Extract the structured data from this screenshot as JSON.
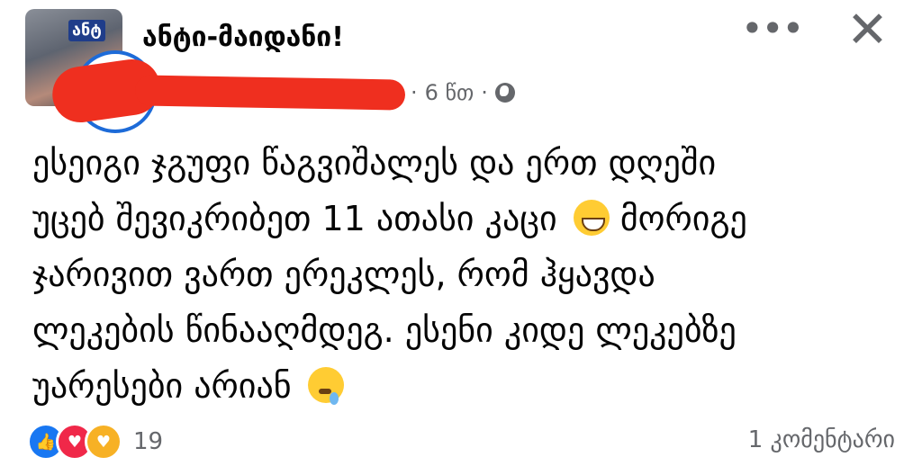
{
  "post": {
    "page_name": "ანტი-მაიდანი!",
    "avatar_badge": "ანტ",
    "time": "6 წთ",
    "separator": "·",
    "text_lines": [
      "ესეიგი ჯგუფი წაგვიშალეს და ერთ დღეში",
      "უცებ შევიკრიბეთ 11 ათასი კაცი",
      "ჯარივით ვართ ერეკლეს, რომ ჰყავდა",
      "ლეკების წინააღმდეგ. ესენი კიდე ლეკებზე",
      "უარესები არიან"
    ],
    "line2_tail": "მორიგე"
  },
  "header": {
    "more_label": "•••",
    "close_label": "✕"
  },
  "footer": {
    "reaction_count": "19",
    "comments_label": "1 კომენტარი"
  },
  "icons": {
    "like": "like-icon",
    "love": "love-icon",
    "care": "care-icon",
    "globe": "globe-icon",
    "grin_emoji": "grinning-emoji",
    "sleepy_emoji": "sleepy-emoji"
  },
  "colors": {
    "like": "#1877f2",
    "love": "#f02849",
    "care": "#f7b125",
    "secondary_text": "#65676b",
    "redaction": "#ef2f1f"
  }
}
